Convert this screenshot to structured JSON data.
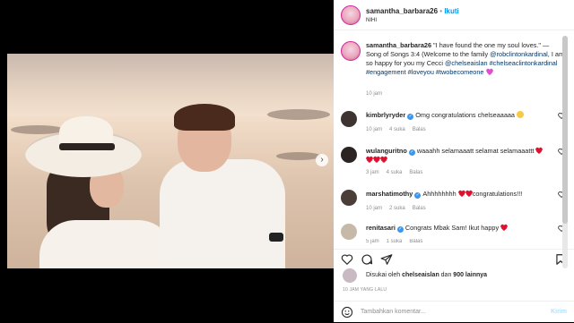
{
  "header": {
    "username": "samantha_barbara26",
    "dot": "•",
    "follow": "Ikuti",
    "location": "NIHI"
  },
  "caption": {
    "username": "samantha_barbara26",
    "text_1": " \"I have found the one my soul loves.\" — Song of Songs 3:4 (Welcome to the family ",
    "mention_1": "@robclintonkardinal",
    "text_2": ", I am so happy for you my Cecci ",
    "mention_2": "@chelseaislan",
    "text_3": " ",
    "tag_1": "#chelseaclintonkardinal",
    "tag_2": "#engagement",
    "tag_3": "#loveyou",
    "tag_4": "#twobecomeone",
    "time": "10 jam"
  },
  "comments": [
    {
      "username": "kimbrlyryder",
      "verified": true,
      "text": "Omg congratulations chelseaaaaa",
      "time": "10 jam",
      "likes": "4 suka",
      "reply": "Balas"
    },
    {
      "username": "wulanguritno",
      "verified": true,
      "text": "waaahh selamaaatt selamat selamaaattt",
      "time": "3 jam",
      "likes": "4 suka",
      "reply": "Balas"
    },
    {
      "username": "marshatimothy",
      "verified": true,
      "text": "Ahhhhhhhh",
      "text_after": "congratulations!!!",
      "time": "10 jam",
      "likes": "2 suka",
      "reply": "Balas"
    },
    {
      "username": "renitasari",
      "verified": true,
      "text": "Congrats Mbak Sam! Ikut happy",
      "time": "5 jam",
      "likes": "1 suka",
      "reply": "Balas"
    }
  ],
  "likes": {
    "prefix": "Disukai oleh ",
    "user": "chelseaislan",
    "middle": " dan ",
    "count": "900 lainnya"
  },
  "timestamp": "10 JAM YANG LALU",
  "add_comment": {
    "placeholder": "Tambahkan komentar...",
    "post": "Kirim"
  },
  "icons": {
    "like": "heart-outline-icon",
    "comment": "comment-icon",
    "share": "send-icon",
    "save": "bookmark-icon",
    "next": "chevron-right-icon",
    "emoji": "smiley-icon"
  },
  "colors": {
    "link": "#00376b",
    "follow": "#0095f6",
    "verified": "#3897f0",
    "heart_red": "#e0112f",
    "heart_pink": "#e64ad2"
  }
}
